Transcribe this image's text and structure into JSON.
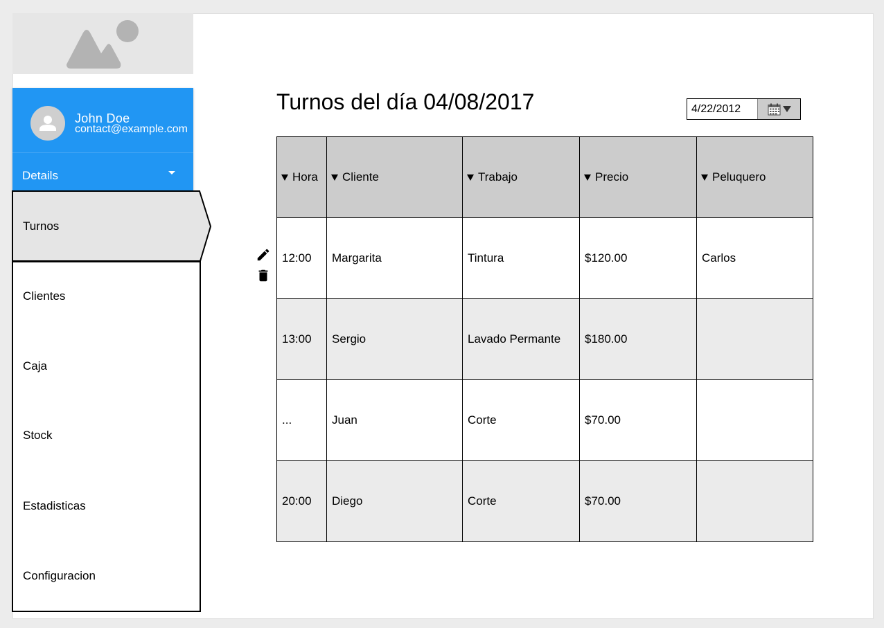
{
  "sidebar": {
    "hero_icon": "image-placeholder-icon",
    "profile": {
      "name": "John Doe",
      "email": "contact@example.com",
      "details_label": "Details",
      "avatar_icon": "person-icon"
    },
    "nav": [
      {
        "label": "Turnos",
        "active": true
      },
      {
        "label": "Clientes"
      },
      {
        "label": "Caja"
      },
      {
        "label": "Stock"
      },
      {
        "label": "Estadisticas"
      },
      {
        "label": "Configuracion"
      }
    ]
  },
  "main": {
    "title": "Turnos del día 04/08/2017",
    "date_picker": {
      "value": "4/22/2012",
      "icon": "calendar-icon"
    },
    "table": {
      "columns": [
        "Hora",
        "Cliente",
        "Trabajo",
        "Precio",
        "Peluquero"
      ],
      "rows": [
        [
          "12:00",
          "Margarita",
          "Tintura",
          "$120.00",
          "Carlos"
        ],
        [
          "13:00",
          "Sergio",
          "Lavado Permante",
          "$180.00",
          ""
        ],
        [
          "...",
          "Juan",
          "Corte",
          "$70.00",
          ""
        ],
        [
          "20:00",
          "Diego",
          "Corte",
          "$70.00",
          ""
        ]
      ]
    },
    "row_actions": {
      "edit_icon": "pencil-icon",
      "delete_icon": "trash-icon"
    }
  },
  "colors": {
    "accent": "#2196f3",
    "header_bg": "#cccccc",
    "alt_row_bg": "#ebebeb",
    "page_bg": "#ececec"
  }
}
